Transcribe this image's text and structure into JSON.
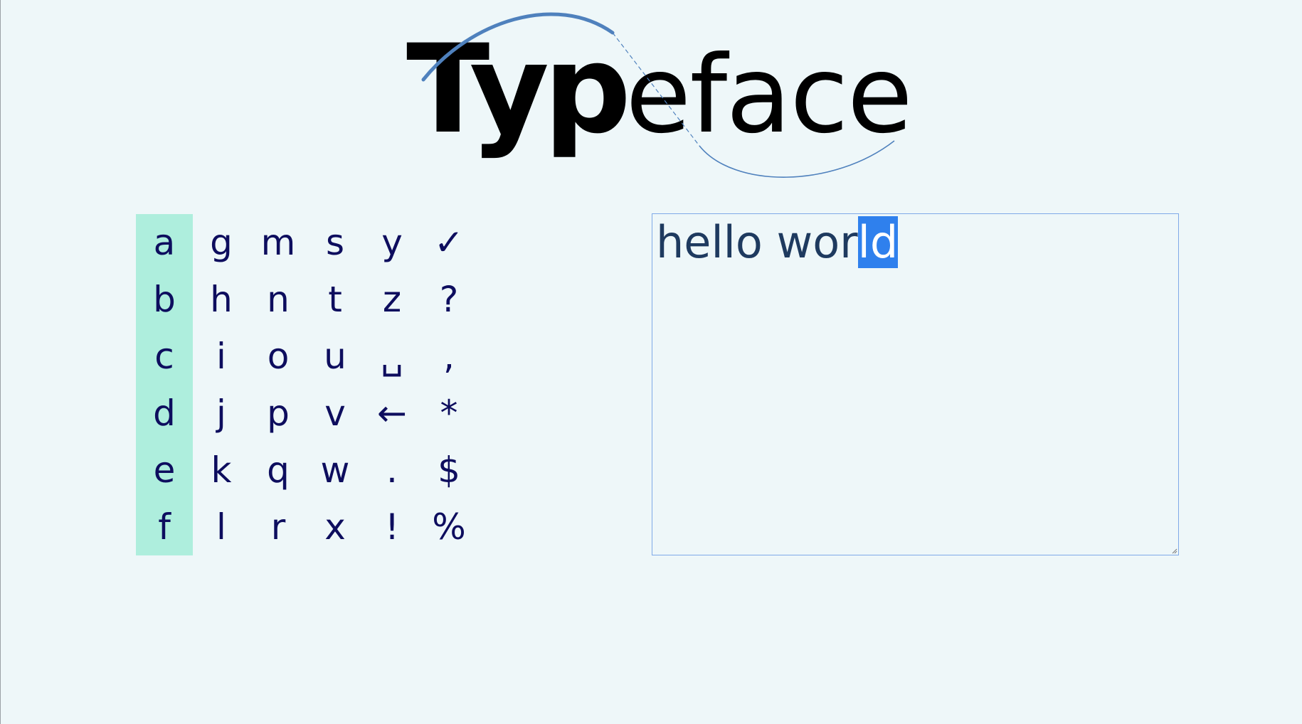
{
  "logo": {
    "bold_text": "Typ",
    "light_text": "eface"
  },
  "keyboard": {
    "active_column": 0,
    "columns": [
      [
        "a",
        "b",
        "c",
        "d",
        "e",
        "f"
      ],
      [
        "g",
        "h",
        "i",
        "j",
        "k",
        "l"
      ],
      [
        "m",
        "n",
        "o",
        "p",
        "q",
        "r"
      ],
      [
        "s",
        "t",
        "u",
        "v",
        "w",
        "x"
      ],
      [
        "y",
        "z",
        "␣",
        "←",
        ".",
        "!"
      ],
      [
        "✓",
        "?",
        ",",
        "*",
        "$",
        "%"
      ]
    ],
    "key_names": {
      "␣": "space",
      "←": "backspace",
      "✓": "enter",
      "?": "question-mark",
      ",": "comma",
      "*": "asterisk",
      "$": "dollar",
      "%": "percent",
      ".": "period",
      "!": "exclamation"
    }
  },
  "text_area": {
    "unselected": "hello wor",
    "selected": "ld"
  },
  "colors": {
    "background": "#eef7f9",
    "active_column_highlight": "#aeeedd",
    "key_text": "#0d0d5e",
    "text_color": "#1e3a5f",
    "selection": "#2f80ed",
    "textarea_border": "#7fa9e8",
    "logo_arc": "#4f81bd"
  }
}
